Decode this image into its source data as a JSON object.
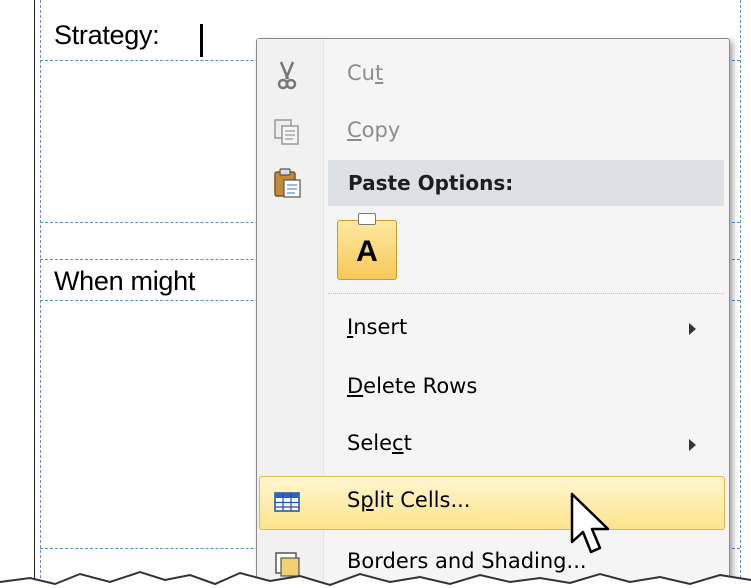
{
  "document": {
    "line1": "Strategy:",
    "line2": "When  might"
  },
  "context_menu": {
    "cut": {
      "pre": "Cu",
      "key": "t",
      "post": "",
      "icon": "scissors-icon"
    },
    "copy": {
      "pre": "",
      "key": "C",
      "post": "opy",
      "icon": "copy-icon"
    },
    "paste_header": {
      "label": "Paste Options:",
      "icon": "paste-icon"
    },
    "paste_keep_text": {
      "glyph": "A",
      "icon": "keep-text-only-icon"
    },
    "insert": {
      "pre": "",
      "key": "I",
      "post": "nsert"
    },
    "delete_rows": {
      "pre": "",
      "key": "D",
      "post": "elete Rows"
    },
    "select": {
      "pre": "Sele",
      "key": "c",
      "post": "t"
    },
    "split_cells": {
      "pre": "S",
      "key": "p",
      "post": "lit Cells...",
      "icon": "split-cells-icon"
    },
    "borders": {
      "label": "Borders and Shading...",
      "icon": "borders-icon"
    }
  }
}
